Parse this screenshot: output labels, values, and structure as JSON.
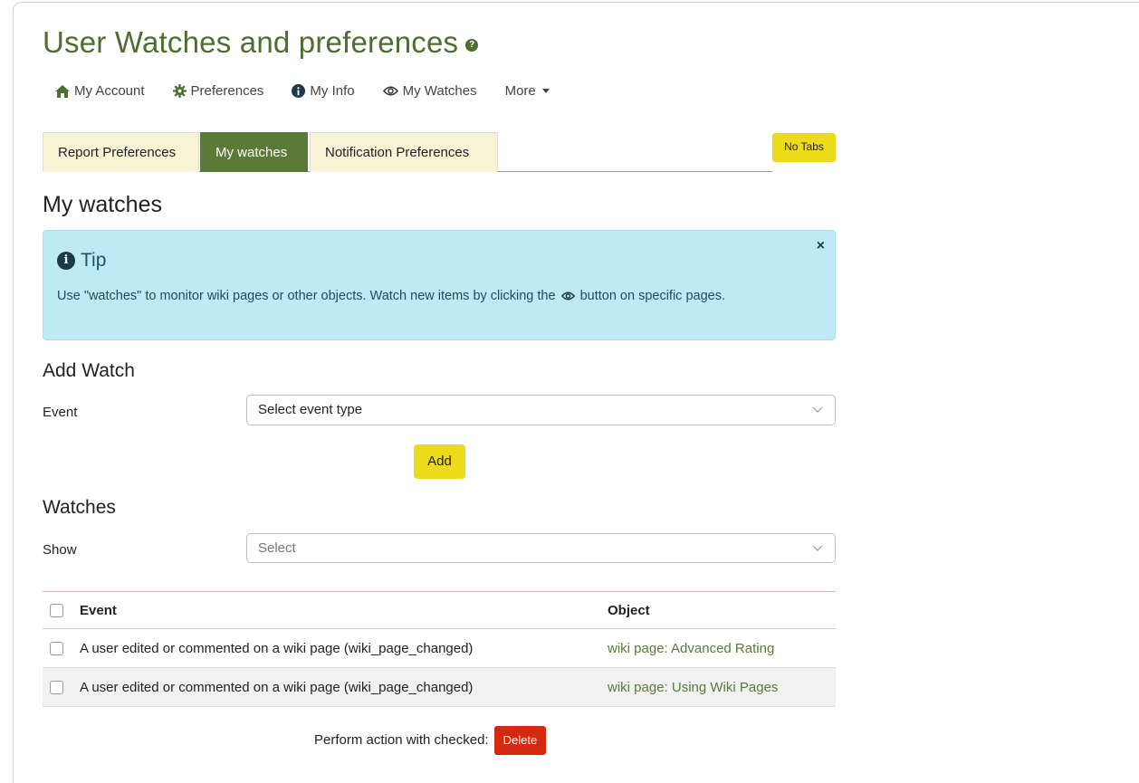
{
  "page": {
    "title": "User Watches and preferences"
  },
  "nav": {
    "items": [
      {
        "label": "My Account",
        "icon": "home-icon"
      },
      {
        "label": "Preferences",
        "icon": "gear-icon"
      },
      {
        "label": "My Info",
        "icon": "info-icon"
      },
      {
        "label": "My Watches",
        "icon": "eye-icon"
      },
      {
        "label": "More",
        "icon": "caret-down-icon"
      }
    ]
  },
  "tabs": [
    {
      "label": "Report Preferences",
      "active": false
    },
    {
      "label": "My watches",
      "active": true
    },
    {
      "label": "Notification Preferences",
      "active": false
    }
  ],
  "no_tabs_label": "No Tabs",
  "section_title": "My watches",
  "tip": {
    "title": "Tip",
    "text_before": "Use \"watches\" to monitor wiki pages or other objects. Watch new items by clicking the",
    "text_after": "button on specific pages.",
    "close": "×"
  },
  "add_watch": {
    "heading": "Add Watch",
    "event_label": "Event",
    "event_value": "Select event type",
    "add_button": "Add"
  },
  "watches": {
    "heading": "Watches",
    "show_label": "Show",
    "show_placeholder": "Select",
    "columns": {
      "event": "Event",
      "object": "Object"
    },
    "rows": [
      {
        "event": "A user edited or commented on a wiki page (wiki_page_changed)",
        "object": "wiki page: Advanced Rating"
      },
      {
        "event": "A user edited or commented on a wiki page (wiki_page_changed)",
        "object": "wiki page: Using Wiki Pages"
      }
    ],
    "perform_label": "Perform action with checked:",
    "delete_button": "Delete"
  },
  "colors": {
    "brand_green": "#5a7a38",
    "title_green": "#4d6e2e",
    "accent_yellow": "#ecdb1a",
    "tab_bg": "#f7f3d5",
    "tip_bg": "#bfeaf5",
    "danger_red": "#d22a0e"
  }
}
